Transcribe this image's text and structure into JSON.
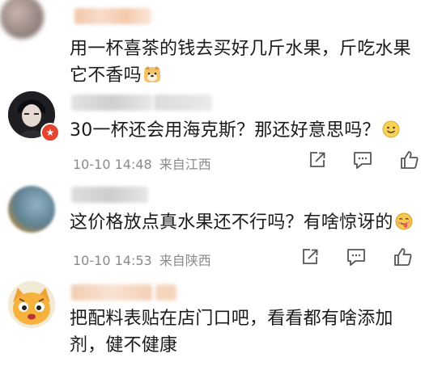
{
  "comments": [
    {
      "text_line1": "用一杯喜茶的钱去买好几斤水果，斤吃水果",
      "text_line2": "它不香吗",
      "emoji": "dog-face-emoji"
    },
    {
      "text": "30一杯还会用海克斯？那还好意思吗？",
      "emoji": "slight-smile-emoji",
      "time": "10-10 14:48",
      "location": "来自江西"
    },
    {
      "text": "这价格放点真水果还不行吗？有啥惊讶的",
      "emoji": "tongue-face-emoji",
      "time": "10-10 14:53",
      "location": "来自陕西"
    },
    {
      "text_line1": "把配料表贴在店门口吧，看看都有啥添加",
      "text_line2": "剂，健不健康"
    }
  ],
  "actions": [
    "share-icon",
    "comment-icon",
    "like-icon"
  ],
  "colors": {
    "meta": "#8a8a8a",
    "badge": "#e6432e"
  }
}
